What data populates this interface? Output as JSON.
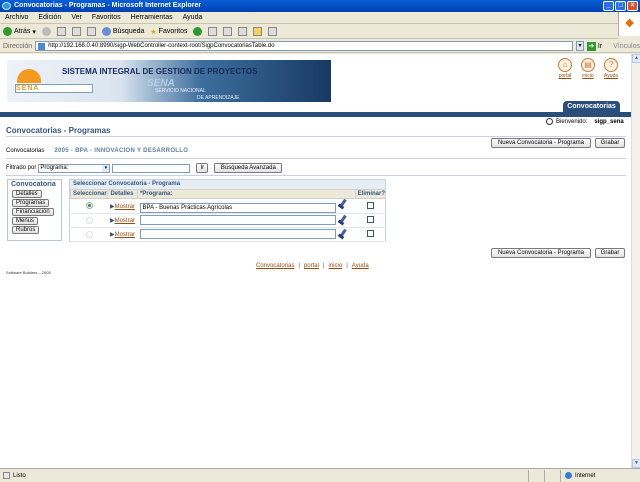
{
  "window": {
    "title": "Convocatorias - Programas - Microsoft Internet Explorer",
    "controls": [
      "_",
      "□",
      "×"
    ]
  },
  "menu": [
    "Archivo",
    "Edición",
    "Ver",
    "Favoritos",
    "Herramientas",
    "Ayuda"
  ],
  "toolbar": {
    "back": "Atrás",
    "search": "Búsqueda",
    "favorites": "Favoritos"
  },
  "address": {
    "label": "Dirección",
    "url": "http://192.168.0.40:8990/sigp-WebController-context-root/SigpConvocatoriasTable.do",
    "go": "Ir",
    "links": "Vínculos"
  },
  "header": {
    "banner_title": "SISTEMA INTEGRAL DE GESTION DE PROYECTOS",
    "logo_text": "SENA",
    "banner_sena": "SENA",
    "banner_servicio": "SERVICIO NACIONAL",
    "banner_aprendizaje": "DE APRENDIZAJE",
    "icons": [
      {
        "label": "portal",
        "glyph": "⌂"
      },
      {
        "label": "inicio",
        "glyph": "▤"
      },
      {
        "label": "Ayuda",
        "glyph": "?"
      }
    ],
    "tab": "Convocatorias",
    "welcome_label": "Bienvenido:",
    "user": "sigp_sena"
  },
  "page": {
    "title": "Convocatorias - Programas",
    "new_button": "Nueva Convocatoria - Programa",
    "save_button": "Grabar",
    "conv_label": "Convocatorias",
    "conv_value": "2005 - BPA - INNOVACION Y DESARROLLO",
    "filter_label": "Filtrado por",
    "filter_value": "Programa:",
    "filter_go": "Ir",
    "advanced_search": "Búsqueda Avanzada"
  },
  "sidebar": {
    "title": "Convocatoria",
    "items": [
      "Detalles",
      "Programas",
      "Financiación",
      "Menus",
      "Rubros"
    ]
  },
  "grid": {
    "title": "Seleccionar Convocatoria - Programa",
    "headers": [
      "Seleccionar",
      "Detalles",
      "*Programa:",
      "Eliminar?"
    ],
    "show_label": "Mostrar",
    "rows": [
      {
        "selected": true,
        "programa": "BPA - Buenas Prácticas Agrícolas"
      },
      {
        "selected": false,
        "programa": ""
      },
      {
        "selected": false,
        "programa": ""
      }
    ]
  },
  "footer": {
    "links": [
      "Convocatorias",
      "portal",
      "inicio",
      "Ayuda"
    ],
    "credit": "Software Builders – 2005"
  },
  "status": {
    "text": "Listo",
    "zone": "Internet"
  }
}
